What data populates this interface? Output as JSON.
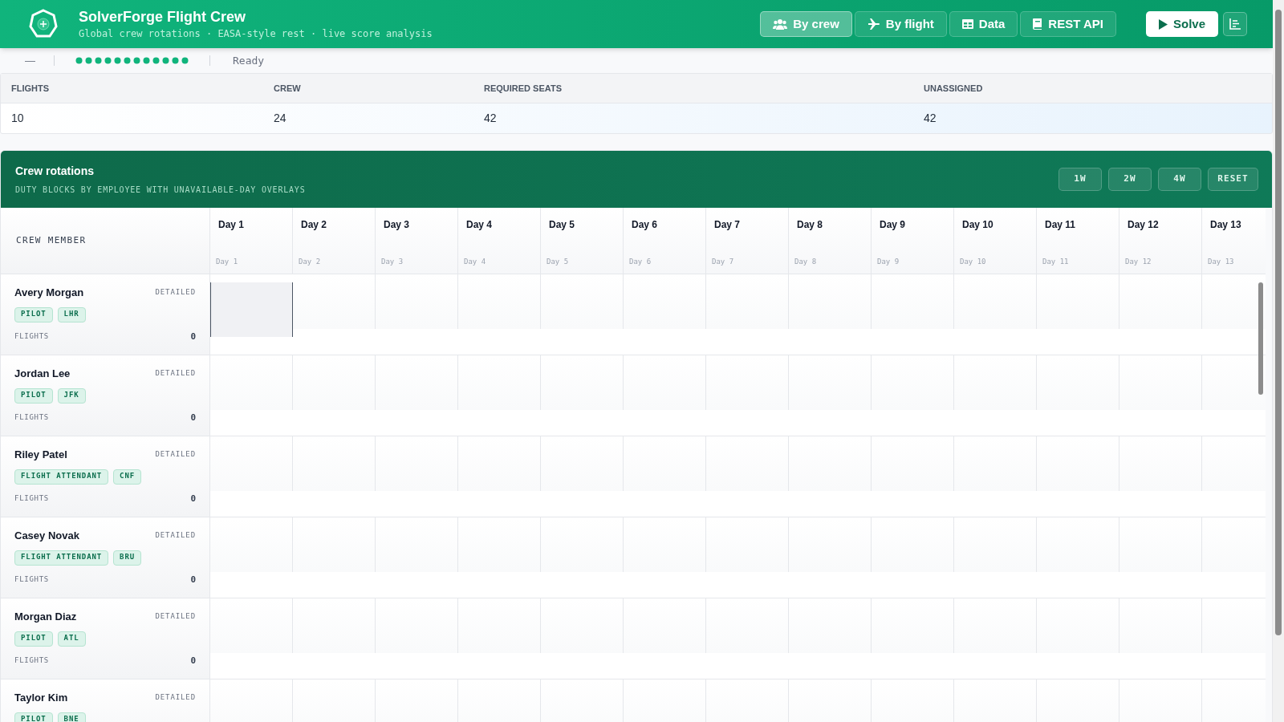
{
  "app": {
    "title": "SolverForge Flight Crew",
    "subtitle": "Global crew rotations · EASA-style rest · live score analysis"
  },
  "nav": [
    {
      "label": "By crew",
      "kind": "crew",
      "selected": true
    },
    {
      "label": "By flight",
      "kind": "flight",
      "selected": false
    },
    {
      "label": "Data",
      "kind": "data",
      "selected": false
    },
    {
      "label": "REST API",
      "kind": "api",
      "selected": false
    }
  ],
  "solve_button": "Solve",
  "status_bar": {
    "score": "—",
    "status": "Ready"
  },
  "stats": [
    {
      "label": "FLIGHTS",
      "value": "10"
    },
    {
      "label": "CREW",
      "value": "24"
    },
    {
      "label": "REQUIRED SEATS",
      "value": "42"
    },
    {
      "label": "UNASSIGNED",
      "value": "42"
    }
  ],
  "panel": {
    "title": "Crew rotations",
    "subtitle": "DUTY BLOCKS BY EMPLOYEE WITH UNAVAILABLE-DAY OVERLAYS",
    "zoom_buttons": [
      "1W",
      "2W",
      "4W",
      "RESET"
    ]
  },
  "grid": {
    "crew_column": "CREW MEMBER",
    "days": [
      {
        "label": "Day 1",
        "sub": "Day 1"
      },
      {
        "label": "Day 2",
        "sub": "Day 2"
      },
      {
        "label": "Day 3",
        "sub": "Day 3"
      },
      {
        "label": "Day 4",
        "sub": "Day 4"
      },
      {
        "label": "Day 5",
        "sub": "Day 5"
      },
      {
        "label": "Day 6",
        "sub": "Day 6"
      },
      {
        "label": "Day 7",
        "sub": "Day 7"
      },
      {
        "label": "Day 8",
        "sub": "Day 8"
      },
      {
        "label": "Day 9",
        "sub": "Day 9"
      },
      {
        "label": "Day 10",
        "sub": "Day 10"
      },
      {
        "label": "Day 11",
        "sub": "Day 11"
      },
      {
        "label": "Day 12",
        "sub": "Day 12"
      },
      {
        "label": "Day 13",
        "sub": "Day 13"
      }
    ],
    "crew": [
      {
        "name": "Avery Morgan",
        "mode": "DETAILED",
        "tags": [
          "PILOT",
          "LHR"
        ],
        "flights_label": "FLIGHTS",
        "flights": "0",
        "cells": [
          true,
          false,
          false,
          false,
          false,
          false,
          false,
          false,
          false,
          false,
          false,
          false,
          false
        ]
      },
      {
        "name": "Jordan Lee",
        "mode": "DETAILED",
        "tags": [
          "PILOT",
          "JFK"
        ],
        "flights_label": "FLIGHTS",
        "flights": "0",
        "cells": [
          false,
          false,
          false,
          false,
          false,
          false,
          false,
          false,
          false,
          false,
          false,
          false,
          false
        ]
      },
      {
        "name": "Riley Patel",
        "mode": "DETAILED",
        "tags": [
          "FLIGHT ATTENDANT",
          "CNF"
        ],
        "flights_label": "FLIGHTS",
        "flights": "0",
        "cells": [
          false,
          false,
          false,
          false,
          false,
          false,
          false,
          false,
          false,
          false,
          false,
          false,
          false
        ]
      },
      {
        "name": "Casey Novak",
        "mode": "DETAILED",
        "tags": [
          "FLIGHT ATTENDANT",
          "BRU"
        ],
        "flights_label": "FLIGHTS",
        "flights": "0",
        "cells": [
          false,
          false,
          false,
          false,
          false,
          false,
          false,
          false,
          false,
          false,
          false,
          false,
          false
        ]
      },
      {
        "name": "Morgan Diaz",
        "mode": "DETAILED",
        "tags": [
          "PILOT",
          "ATL"
        ],
        "flights_label": "FLIGHTS",
        "flights": "0",
        "cells": [
          false,
          false,
          false,
          false,
          false,
          false,
          false,
          false,
          false,
          false,
          false,
          false,
          false
        ]
      },
      {
        "name": "Taylor Kim",
        "mode": "DETAILED",
        "tags": [
          "PILOT",
          "BNE"
        ],
        "cells": [
          false,
          false,
          false,
          false,
          false,
          false,
          false,
          false,
          false,
          false,
          false,
          false,
          false
        ]
      }
    ]
  }
}
